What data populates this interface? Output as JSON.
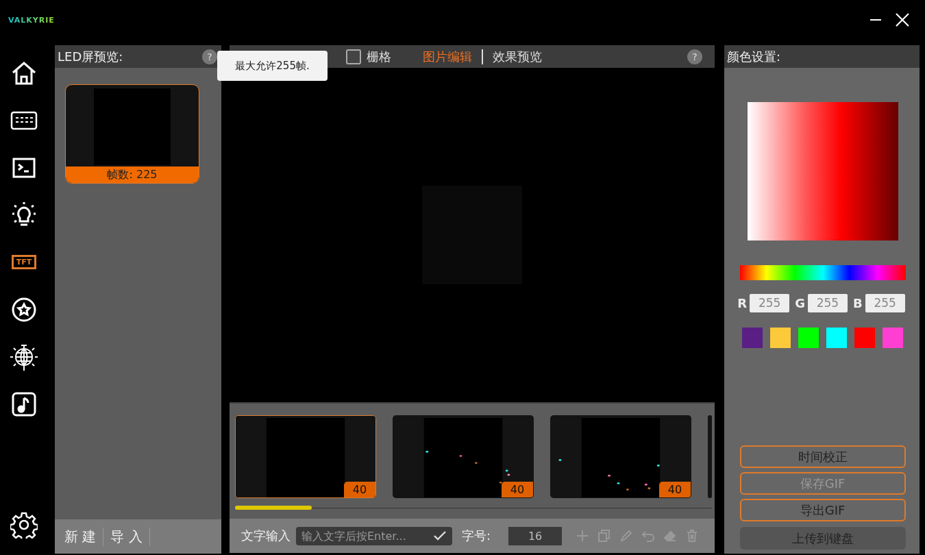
{
  "logo": "VALKYRIE",
  "sidebar": {
    "items": [
      {
        "kind": "home",
        "selected": false
      },
      {
        "kind": "keyboard",
        "selected": false
      },
      {
        "kind": "terminal",
        "selected": false
      },
      {
        "kind": "bulb",
        "selected": false
      },
      {
        "kind": "tft",
        "label": "TFT",
        "selected": true
      },
      {
        "kind": "star",
        "selected": false
      },
      {
        "kind": "disco",
        "selected": false
      },
      {
        "kind": "music",
        "selected": false
      }
    ],
    "settings": {
      "kind": "gear"
    }
  },
  "left_panel": {
    "title": "LED屏预览:",
    "help": "?",
    "preview": {
      "selected": true,
      "caption": "帧数: 225"
    },
    "footer": [
      "新 建",
      "导 入"
    ]
  },
  "tooltip": "最大允许255帧.",
  "center_panel": {
    "grid": {
      "label": "栅格",
      "checked": false
    },
    "tabs": [
      {
        "label": "图片编辑",
        "selected": true
      },
      {
        "label": "效果预览",
        "selected": false
      }
    ],
    "help": "?",
    "frames": [
      {
        "count": "40",
        "selected": true
      },
      {
        "count": "40",
        "selected": false
      },
      {
        "count": "40",
        "selected": false
      }
    ],
    "toolbar": {
      "text_label": "文字输入",
      "text_placeholder": "输入文字后按Enter...",
      "size_label": "字号:",
      "size_value": "16",
      "tools": [
        {
          "kind": "plus",
          "disabled": true
        },
        {
          "kind": "copy",
          "disabled": true
        },
        {
          "kind": "pencil",
          "disabled": true
        },
        {
          "kind": "undo",
          "disabled": true
        },
        {
          "kind": "eraser",
          "disabled": true
        },
        {
          "kind": "trash",
          "disabled": true
        }
      ]
    }
  },
  "right_panel": {
    "title": "颜色设置:",
    "rgb": [
      {
        "label": "R",
        "value": "255"
      },
      {
        "label": "G",
        "value": "255"
      },
      {
        "label": "B",
        "value": "255"
      }
    ],
    "swatches": [
      {
        "color": "#5a1f85"
      },
      {
        "color": "#fcc93a"
      },
      {
        "color": "#00ff00"
      },
      {
        "color": "#00ffff"
      },
      {
        "color": "#ff0000"
      },
      {
        "color": "#ff3fd2"
      }
    ],
    "buttons": [
      {
        "label": "时间校正",
        "kind": "outline",
        "disabled": false
      },
      {
        "label": "保存GIF",
        "kind": "outline",
        "disabled": true
      },
      {
        "label": "导出GIF",
        "kind": "outline",
        "disabled": false
      },
      {
        "label": "上传到键盘",
        "kind": "filled",
        "disabled": false
      }
    ]
  }
}
